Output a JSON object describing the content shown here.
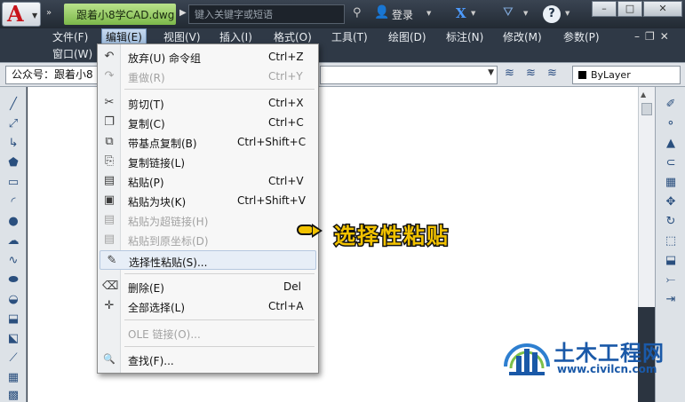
{
  "titlebar": {
    "app_logo": "A",
    "file_title": "跟着小8学CAD.dwg",
    "search_placeholder": "键入关键字或短语",
    "login": "登录",
    "help_icon": "?",
    "win_min": "–",
    "win_restore": "□",
    "win_close": "✕"
  },
  "menubar": {
    "items": [
      "文件(F)",
      "编辑(E)",
      "视图(V)",
      "插入(I)",
      "格式(O)",
      "工具(T)",
      "绘图(D)",
      "标注(N)",
      "修改(M)",
      "参数(P)"
    ],
    "window_menu": "窗口(W)",
    "active_item": "编辑(E)"
  },
  "toolbar": {
    "workspace_combo": "公众号：跟着小8",
    "bylayer": "ByLayer"
  },
  "edit_menu": {
    "items": [
      {
        "label": "放弃(U) 命令组",
        "shortcut": "Ctrl+Z",
        "icon": "undo-icon",
        "glyph": "↶",
        "enabled": true
      },
      {
        "label": "重做(R)",
        "shortcut": "Ctrl+Y",
        "icon": "redo-icon",
        "glyph": "↷",
        "enabled": false
      },
      {
        "label": "剪切(T)",
        "shortcut": "Ctrl+X",
        "icon": "scissors-icon",
        "glyph": "✂",
        "enabled": true
      },
      {
        "label": "复制(C)",
        "shortcut": "Ctrl+C",
        "icon": "copy-icon",
        "glyph": "❐",
        "enabled": true
      },
      {
        "label": "带基点复制(B)",
        "shortcut": "Ctrl+Shift+C",
        "icon": "copy-base-icon",
        "glyph": "⧉",
        "enabled": true
      },
      {
        "label": "复制链接(L)",
        "shortcut": "",
        "icon": "copy-link-icon",
        "glyph": "⎘",
        "enabled": true
      },
      {
        "label": "粘贴(P)",
        "shortcut": "Ctrl+V",
        "icon": "paste-icon",
        "glyph": "▤",
        "enabled": true
      },
      {
        "label": "粘贴为块(K)",
        "shortcut": "Ctrl+Shift+V",
        "icon": "paste-block-icon",
        "glyph": "▣",
        "enabled": true
      },
      {
        "label": "粘贴为超链接(H)",
        "shortcut": "",
        "icon": "paste-hyperlink-icon",
        "glyph": "▤",
        "enabled": false
      },
      {
        "label": "粘贴到原坐标(D)",
        "shortcut": "",
        "icon": "paste-orig-icon",
        "glyph": "▤",
        "enabled": false
      },
      {
        "label": "选择性粘贴(S)...",
        "shortcut": "",
        "icon": "paste-special-icon",
        "glyph": "✎",
        "enabled": true,
        "highlight": true
      },
      {
        "label": "删除(E)",
        "shortcut": "Del",
        "icon": "eraser-icon",
        "glyph": "⌫",
        "enabled": true
      },
      {
        "label": "全部选择(L)",
        "shortcut": "Ctrl+A",
        "icon": "select-all-icon",
        "glyph": "✛",
        "enabled": true
      },
      {
        "label": "OLE 链接(O)...",
        "shortcut": "",
        "icon": "",
        "glyph": "",
        "enabled": false
      },
      {
        "label": "查找(F)...",
        "shortcut": "",
        "icon": "find-icon",
        "glyph": "🔍",
        "enabled": true
      }
    ]
  },
  "annotation": {
    "text": "选择性粘贴"
  },
  "watermark": {
    "name": "土木工程网",
    "url": "www.civilcn.com"
  },
  "colors": {
    "accent": "#f2c200",
    "title_bg": "#2b3440",
    "file_tab": "#9dd46b",
    "watermark": "#1a59a8"
  }
}
